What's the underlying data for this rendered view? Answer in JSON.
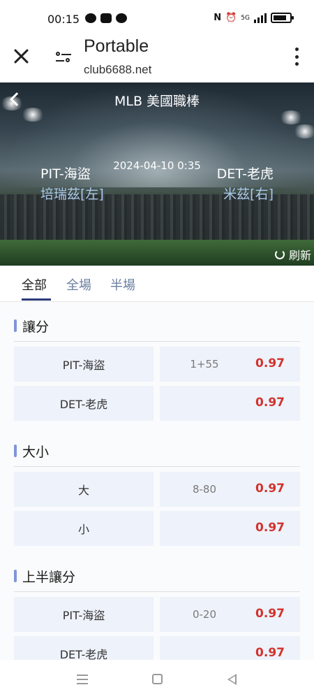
{
  "status_bar": {
    "time": "00:15",
    "network_label": "5G",
    "app_icons": [
      "chat-bubble-icon",
      "youtube-icon",
      "line-icon"
    ],
    "system_icons": [
      "nfc-icon",
      "alarm-icon",
      "signal-icon",
      "battery-icon"
    ]
  },
  "browser": {
    "title": "Portable",
    "url": "club6688.net"
  },
  "game": {
    "league": "MLB 美國職棒",
    "datetime": "2024-04-10 0:35",
    "home_team": "PIT-海盜",
    "home_pitcher": "培瑞茲[左]",
    "away_team": "DET-老虎",
    "away_pitcher": "米茲[右]",
    "refresh_label": "刷新"
  },
  "tabs": [
    {
      "label": "全部",
      "active": true
    },
    {
      "label": "全場",
      "active": false
    },
    {
      "label": "半場",
      "active": false
    }
  ],
  "markets": [
    {
      "title": "讓分",
      "rows": [
        {
          "selection": "PIT-海盜",
          "line": "1+55",
          "odds": "0.97"
        },
        {
          "selection": "DET-老虎",
          "line": "",
          "odds": "0.97"
        }
      ]
    },
    {
      "title": "大小",
      "rows": [
        {
          "selection": "大",
          "line": "8-80",
          "odds": "0.97"
        },
        {
          "selection": "小",
          "line": "",
          "odds": "0.97"
        }
      ]
    },
    {
      "title": "上半讓分",
      "rows": [
        {
          "selection": "PIT-海盜",
          "line": "0-20",
          "odds": "0.97"
        },
        {
          "selection": "DET-老虎",
          "line": "",
          "odds": "0.97"
        }
      ]
    }
  ],
  "colors": {
    "odds": "#d2322d",
    "accent": "#2a3a78",
    "cell_background": "#eef2fa",
    "pitcher_text": "#a9c9ec"
  }
}
